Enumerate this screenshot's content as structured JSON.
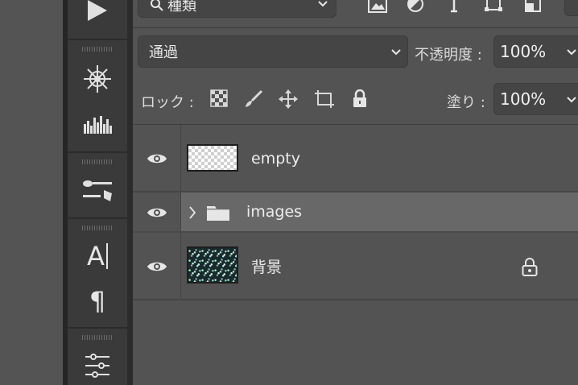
{
  "toolbar": {
    "tools": [
      {
        "icon": "play-icon"
      },
      {
        "icon": "network-wheel-icon"
      },
      {
        "icon": "histogram-icon"
      },
      {
        "icon": "brush-settings-icon"
      },
      {
        "icon": "character-icon",
        "label": "A"
      },
      {
        "icon": "paragraph-icon",
        "label": "¶"
      },
      {
        "icon": "adjustments-icon"
      }
    ]
  },
  "layers_panel": {
    "filter": {
      "label": "種類",
      "icons": [
        "search-icon",
        "image-filter-icon",
        "adjustment-filter-icon",
        "type-filter-icon",
        "shape-filter-icon",
        "smart-object-filter-icon"
      ]
    },
    "blend_mode": "通過",
    "opacity_label": "不透明度 :",
    "opacity_value": "100%",
    "lock_label": "ロック :",
    "lock_icons": [
      "lock-transparent-pixels-icon",
      "lock-image-pixels-icon",
      "lock-position-icon",
      "lock-artboard-icon",
      "lock-all-icon"
    ],
    "fill_label": "塗り :",
    "fill_value": "100%",
    "layers": [
      {
        "name": "empty",
        "visible": true,
        "type": "layer",
        "thumbnail": "transparent",
        "locked": false,
        "selected": false
      },
      {
        "name": "images",
        "visible": true,
        "type": "group",
        "collapsed": true,
        "locked": false,
        "selected": true
      },
      {
        "name": "背景",
        "visible": true,
        "type": "layer",
        "thumbnail": "image",
        "locked": true,
        "selected": false
      }
    ]
  },
  "colors": {
    "panel_bg": "#535353",
    "selected_row": "#686868",
    "tool_strip": "#3a3a3a",
    "field_bg": "#454545"
  }
}
